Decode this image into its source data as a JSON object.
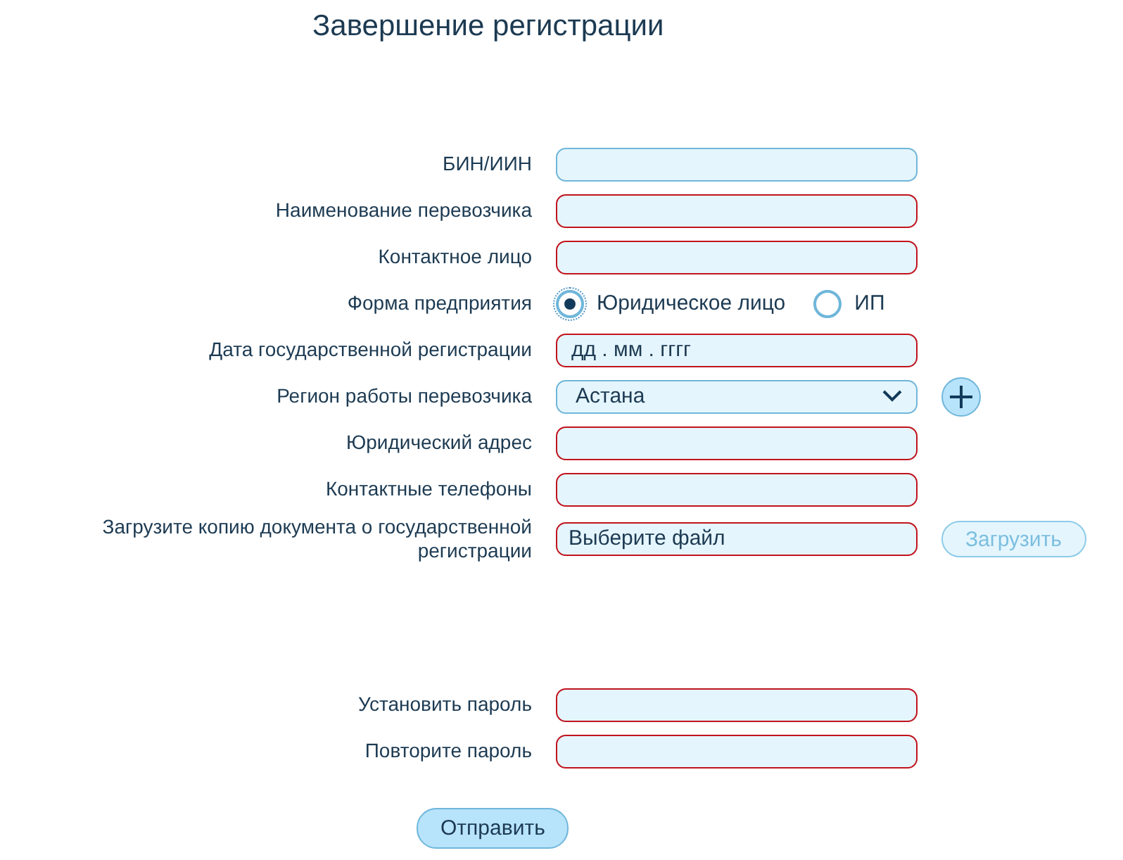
{
  "title": "Завершение регистрации",
  "fields": [
    {
      "kind": "text",
      "label": "БИН/ИИН",
      "invalid": false
    },
    {
      "kind": "text",
      "label": "Наименование перевозчика",
      "invalid": true
    },
    {
      "kind": "text",
      "label": "Контактное лицо",
      "invalid": true
    },
    {
      "kind": "radio",
      "label": "Форма предприятия",
      "options": [
        {
          "label": "Юридическое лицо",
          "selected": true
        },
        {
          "label": "ИП",
          "selected": false
        }
      ]
    },
    {
      "kind": "date",
      "label": "Дата государственной регистрации",
      "invalid": true,
      "placeholder": "дд . мм . гггг"
    },
    {
      "kind": "select",
      "label": "Регион работы перевозчика",
      "invalid": false,
      "value": "Астана"
    },
    {
      "kind": "text",
      "label": "Юридический адрес",
      "invalid": true
    },
    {
      "kind": "text",
      "label": "Контактные телефоны",
      "invalid": true
    },
    {
      "kind": "file",
      "label": "Загрузите копию документа о государственной регистрации",
      "invalid": true,
      "file_text": "Выберите файл",
      "upload_button": {
        "label": "Загрузить",
        "disabled": true
      }
    }
  ],
  "password_fields": [
    {
      "kind": "text",
      "label": "Установить пароль",
      "invalid": true
    },
    {
      "kind": "text",
      "label": "Повторите пароль",
      "invalid": true
    }
  ],
  "submit_button": "Отправить"
}
